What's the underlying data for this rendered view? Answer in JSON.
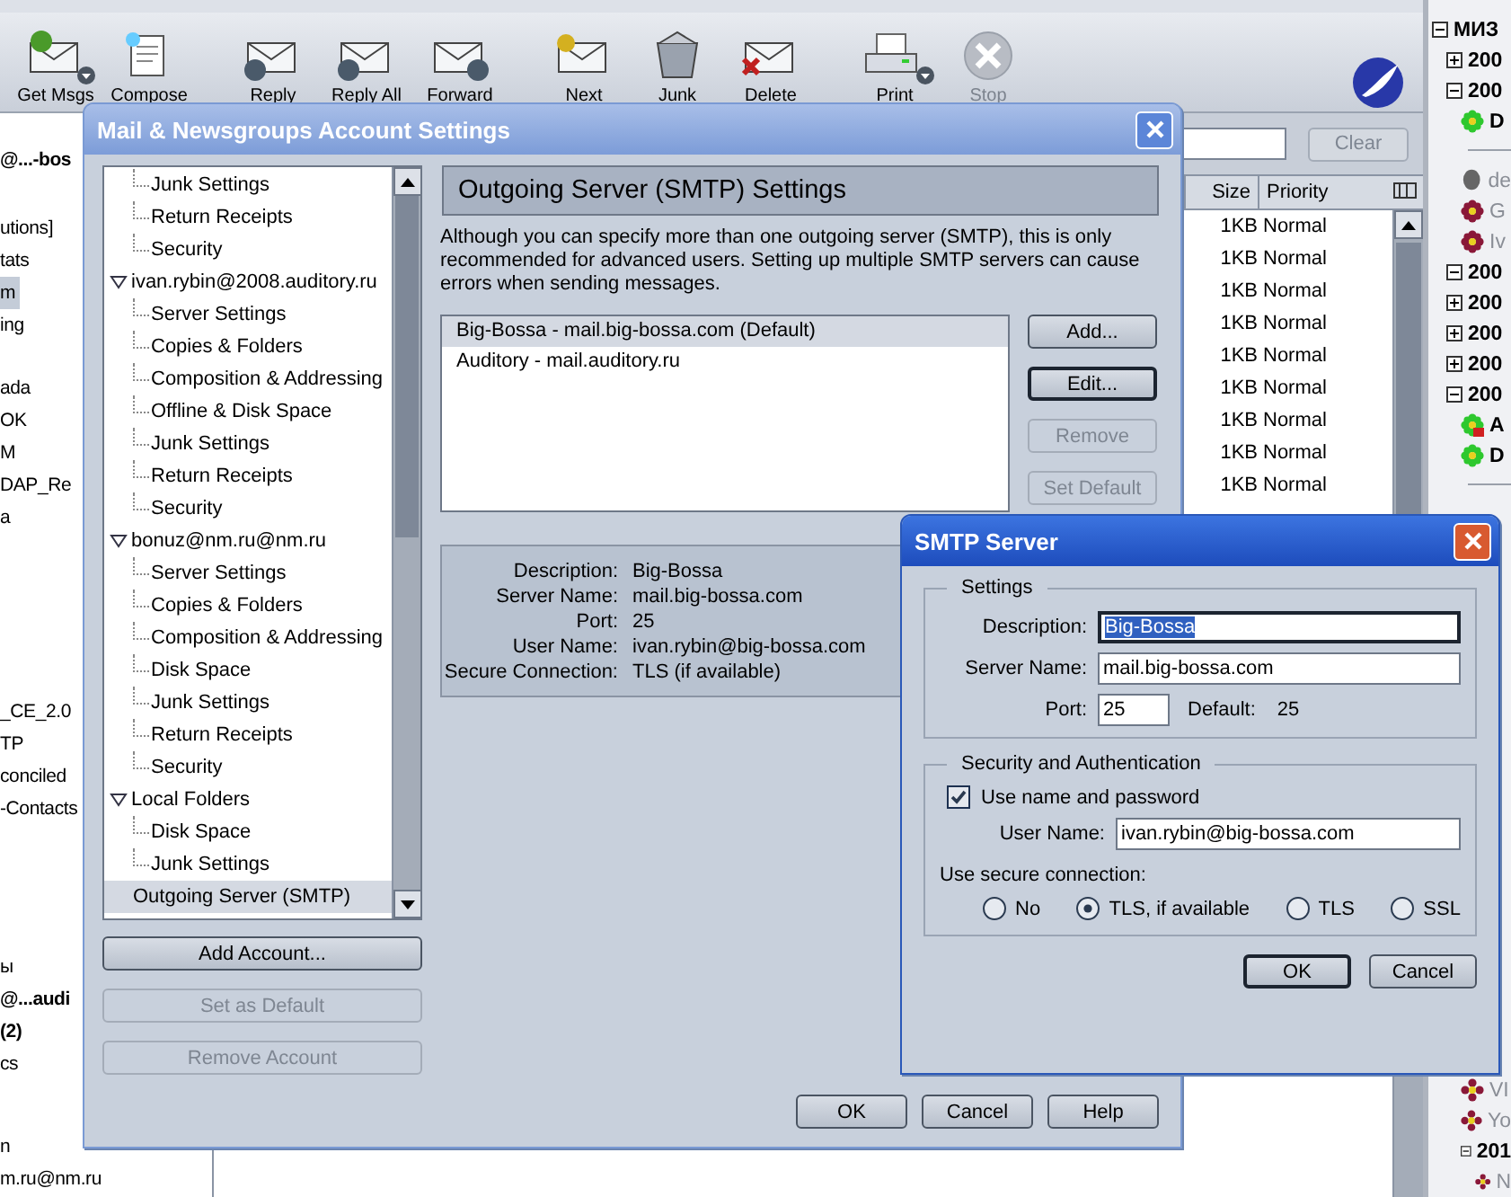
{
  "toolbar": [
    [
      {
        "kind": "get",
        "label": "Get Msgs",
        "disabled": false,
        "dropdown": true
      },
      {
        "kind": "compose",
        "label": "Compose",
        "disabled": false,
        "dropdown": false
      }
    ],
    [
      {
        "kind": "reply",
        "label": "Reply",
        "disabled": false,
        "dropdown": false
      },
      {
        "kind": "reply-all",
        "label": "Reply All",
        "disabled": false,
        "dropdown": false
      },
      {
        "kind": "forward",
        "label": "Forward",
        "disabled": false,
        "dropdown": false
      }
    ],
    [
      {
        "kind": "next",
        "label": "Next",
        "disabled": false,
        "dropdown": false
      },
      {
        "kind": "junk",
        "label": "Junk",
        "disabled": false,
        "dropdown": false
      },
      {
        "kind": "delete",
        "label": "Delete",
        "disabled": false,
        "dropdown": false
      }
    ],
    [
      {
        "kind": "print",
        "label": "Print",
        "disabled": false,
        "dropdown": true
      },
      {
        "kind": "stop",
        "label": "Stop",
        "disabled": true,
        "dropdown": false
      }
    ]
  ],
  "folder_pane": [
    [
      {
        "label": "@...-bos",
        "bold": true,
        "selected": false
      }
    ],
    [
      {
        "label": "utions]",
        "bold": false,
        "selected": false
      },
      {
        "label": "tats",
        "bold": false,
        "selected": false
      },
      {
        "label": "m",
        "bold": false,
        "selected": true
      },
      {
        "label": "ing",
        "bold": false,
        "selected": false
      }
    ],
    [
      {
        "label": "ada",
        "bold": false,
        "selected": false
      },
      {
        "label": "OK",
        "bold": false,
        "selected": false
      },
      {
        "label": "M",
        "bold": false,
        "selected": false
      },
      {
        "label": "DAP_Re",
        "bold": false,
        "selected": false
      },
      {
        "label": "a",
        "bold": false,
        "selected": false
      }
    ],
    [
      {
        "label": "_CE_2.0",
        "bold": false,
        "selected": false
      },
      {
        "label": "TP",
        "bold": false,
        "selected": false
      },
      {
        "label": "conciled",
        "bold": false,
        "selected": false
      },
      {
        "label": "-Contacts",
        "bold": false,
        "selected": false
      }
    ],
    [
      {
        "label": "ы",
        "bold": false,
        "selected": false
      },
      {
        "label": "@...audi",
        "bold": true,
        "selected": false
      },
      {
        "label": "(2)",
        "bold": true,
        "selected": false
      },
      {
        "label": "cs",
        "bold": false,
        "selected": false
      }
    ],
    [
      {
        "label": "n",
        "bold": false,
        "selected": false
      },
      {
        "label": "m.ru@nm.ru",
        "bold": false,
        "selected": false
      }
    ]
  ],
  "message_list": {
    "clear_button": {
      "label": "Clear",
      "disabled": true
    },
    "columns": [
      "Size",
      "Priority"
    ],
    "rows": [
      {
        "size": "1KB",
        "priority": "Normal",
        "selected": false
      },
      {
        "size": "1KB",
        "priority": "Normal",
        "selected": false
      },
      {
        "size": "1KB",
        "priority": "Normal",
        "selected": false
      },
      {
        "size": "1KB",
        "priority": "Normal",
        "selected": false
      },
      {
        "size": "1KB",
        "priority": "Normal",
        "selected": false
      },
      {
        "size": "1KB",
        "priority": "Normal",
        "selected": false
      },
      {
        "size": "1KB",
        "priority": "Normal",
        "selected": false
      },
      {
        "size": "1KB",
        "priority": "Normal",
        "selected": false
      },
      {
        "size": "1KB",
        "priority": "Normal",
        "selected": false
      }
    ]
  },
  "contact_tree": [
    {
      "kind": "group",
      "label": "МИЗ",
      "expanded": true,
      "children": [
        {
          "kind": "group",
          "label": "200",
          "expanded": false
        },
        {
          "kind": "group",
          "label": "200",
          "expanded": true,
          "children": [
            {
              "kind": "contact",
              "label": "D",
              "online": true,
              "message": false
            },
            {
              "kind": "separator"
            },
            {
              "kind": "person",
              "label": "de",
              "online": false
            },
            {
              "kind": "contact",
              "label": "G",
              "online": false,
              "message": false
            },
            {
              "kind": "contact",
              "label": "Iv",
              "online": false,
              "message": false
            }
          ]
        },
        {
          "kind": "group",
          "label": "200",
          "expanded": true
        },
        {
          "kind": "group",
          "label": "200",
          "expanded": false
        },
        {
          "kind": "group",
          "label": "200",
          "expanded": false
        },
        {
          "kind": "group",
          "label": "200",
          "expanded": false
        },
        {
          "kind": "group",
          "label": "200",
          "expanded": true,
          "children": [
            {
              "kind": "contact",
              "label": "A",
              "online": true,
              "message": true
            },
            {
              "kind": "contact",
              "label": "D",
              "online": true,
              "message": false
            },
            {
              "kind": "separator"
            }
          ]
        }
      ]
    }
  ],
  "contact_tree_bottom": [
    {
      "kind": "contact",
      "label": "VI",
      "online": false,
      "message": false
    },
    {
      "kind": "contact",
      "label": "Yo",
      "online": false,
      "message": false
    },
    {
      "kind": "group",
      "label": "201",
      "expanded": true,
      "children": [
        {
          "kind": "contact",
          "label": "N",
          "online": false,
          "message": false
        }
      ]
    }
  ],
  "account_dialog": {
    "title": "Mail & Newsgroups Account Settings",
    "tree": [
      {
        "children": [
          {
            "label": "Junk Settings",
            "selected": false
          },
          {
            "label": "Return Receipts",
            "selected": false
          },
          {
            "label": "Security",
            "selected": false
          }
        ]
      },
      {
        "label": "ivan.rybin@2008.auditory.ru",
        "expanded": true,
        "selected": false,
        "children": [
          {
            "label": "Server Settings",
            "selected": false
          },
          {
            "label": "Copies & Folders",
            "selected": false
          },
          {
            "label": "Composition & Addressing",
            "selected": false
          },
          {
            "label": "Offline & Disk Space",
            "selected": false
          },
          {
            "label": "Junk Settings",
            "selected": false
          },
          {
            "label": "Return Receipts",
            "selected": false
          },
          {
            "label": "Security",
            "selected": false
          }
        ]
      },
      {
        "label": "bonuz@nm.ru@nm.ru",
        "expanded": true,
        "selected": false,
        "children": [
          {
            "label": "Server Settings",
            "selected": false
          },
          {
            "label": "Copies & Folders",
            "selected": false
          },
          {
            "label": "Composition & Addressing",
            "selected": false
          },
          {
            "label": "Disk Space",
            "selected": false
          },
          {
            "label": "Junk Settings",
            "selected": false
          },
          {
            "label": "Return Receipts",
            "selected": false
          },
          {
            "label": "Security",
            "selected": false
          }
        ]
      },
      {
        "label": "Local Folders",
        "expanded": true,
        "selected": false,
        "children": [
          {
            "label": "Disk Space",
            "selected": false
          },
          {
            "label": "Junk Settings",
            "selected": false
          }
        ]
      },
      {
        "label": "Outgoing Server (SMTP)",
        "selected": true
      }
    ],
    "account_buttons": [
      {
        "label": "Add Account...",
        "disabled": false
      },
      {
        "label": "Set as Default",
        "disabled": true
      },
      {
        "label": "Remove Account",
        "disabled": true
      }
    ],
    "heading": "Outgoing Server (SMTP) Settings",
    "description": "Although you can specify more than one outgoing server (SMTP), this is only recommended for advanced users. Setting up multiple SMTP servers can cause errors when sending messages.",
    "servers": [
      {
        "label": "Big-Bossa - mail.big-bossa.com (Default)",
        "selected": true
      },
      {
        "label": "Auditory - mail.auditory.ru",
        "selected": false
      }
    ],
    "server_buttons": [
      {
        "label": "Add...",
        "disabled": false,
        "focused": false
      },
      {
        "label": "Edit...",
        "disabled": false,
        "focused": true
      },
      {
        "label": "Remove",
        "disabled": true,
        "focused": false
      },
      {
        "label": "Set Default",
        "disabled": true,
        "focused": false
      }
    ],
    "details": [
      {
        "label": "Description:",
        "value": "Big-Bossa"
      },
      {
        "label": "Server Name:",
        "value": "mail.big-bossa.com"
      },
      {
        "label": "Port:",
        "value": "25"
      },
      {
        "label": "User Name:",
        "value": "ivan.rybin@big-bossa.com"
      },
      {
        "label": "Secure Connection:",
        "value": "TLS (if available)"
      }
    ],
    "footer_buttons": [
      {
        "label": "OK"
      },
      {
        "label": "Cancel"
      },
      {
        "label": "Help"
      }
    ]
  },
  "smtp_dialog": {
    "title": "SMTP Server",
    "settings": {
      "legend": "Settings",
      "fields": [
        {
          "label": "Description:",
          "value": "Big-Bossa",
          "focused": true,
          "text_selected": true
        },
        {
          "label": "Server Name:",
          "value": "mail.big-bossa.com",
          "focused": false,
          "text_selected": false
        }
      ],
      "port": {
        "label": "Port:",
        "value": "25",
        "default_label": "Default:",
        "default_value": "25"
      }
    },
    "security": {
      "legend": "Security and Authentication",
      "use_password": {
        "label": "Use name and password",
        "checked": true
      },
      "user_name": {
        "label": "User Name:",
        "value": "ivan.rybin@big-bossa.com"
      },
      "secure_label": "Use secure connection:",
      "options": [
        {
          "label": "No",
          "selected": false
        },
        {
          "label": "TLS, if available",
          "selected": true
        },
        {
          "label": "TLS",
          "selected": false
        },
        {
          "label": "SSL",
          "selected": false
        }
      ]
    },
    "buttons": [
      {
        "label": "OK",
        "focused": true
      },
      {
        "label": "Cancel",
        "focused": false
      }
    ]
  }
}
